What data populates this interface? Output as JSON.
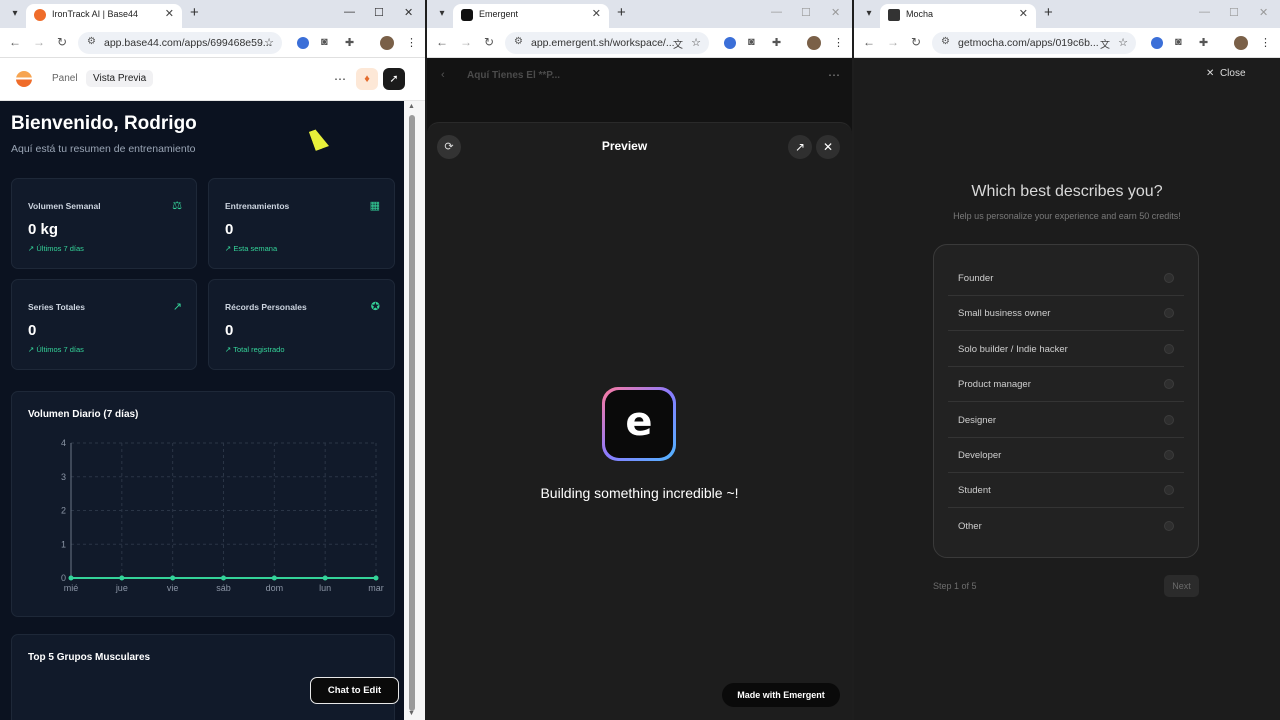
{
  "windows": {
    "base44": {
      "tab_title": "IronTrack AI | Base44",
      "url": "app.base44.com/apps/699468e59...",
      "nav_tabs": [
        "Panel",
        "Vista Previa"
      ],
      "heading": "Bienvenido, Rodrigo",
      "subheading": "Aquí está tu resumen de entrenamiento",
      "stats": [
        {
          "title": "Volumen Semanal",
          "value": "0 kg",
          "sub": "↗ Últimos 7 días",
          "icon": "weight-icon"
        },
        {
          "title": "Entrenamientos",
          "value": "0",
          "sub": "↗ Esta semana",
          "icon": "calendar-icon"
        },
        {
          "title": "Series Totales",
          "value": "0",
          "sub": "↗ Últimos 7 días",
          "icon": "trend-up-icon"
        },
        {
          "title": "Récords Personales",
          "value": "0",
          "sub": "↗ Total registrado",
          "icon": "award-icon"
        }
      ],
      "chart_title": "Volumen Diario (7 días)",
      "top_title": "Top 5 Grupos Musculares",
      "chat_button": "Chat to Edit"
    },
    "emergent": {
      "tab_title": "Emergent",
      "url": "app.emergent.sh/workspace/...",
      "header_title": "Aquí Tienes El **P...",
      "preview_title": "Preview",
      "logo_letter": "e",
      "building_text": "Building something incredible ~!",
      "made_with": "Made with Emergent"
    },
    "mocha": {
      "tab_title": "Mocha",
      "url": "getmocha.com/apps/019c6b...",
      "close_label": "Close",
      "question": "Which best describes you?",
      "subtitle": "Help us personalize your experience and earn 50 credits!",
      "options": [
        "Founder",
        "Small business owner",
        "Solo builder / Indie hacker",
        "Product manager",
        "Designer",
        "Developer",
        "Student",
        "Other"
      ],
      "step": "Step 1 of 5",
      "next": "Next"
    }
  },
  "chart_data": {
    "type": "line",
    "title": "Volumen Diario (7 días)",
    "categories": [
      "mié",
      "jue",
      "vie",
      "sáb",
      "dom",
      "lun",
      "mar"
    ],
    "series": [
      {
        "values": [
          0,
          0,
          0,
          0,
          0,
          0,
          0
        ]
      }
    ],
    "yticks": [
      0,
      1,
      2,
      3,
      4
    ],
    "ylim": [
      0,
      4
    ],
    "grid": true,
    "color": "#34d399"
  },
  "colors": {
    "accent_green": "#34d399",
    "base44_bg": "#0b1220",
    "emergent_bg": "#131313",
    "mocha_bg": "#1c1c1c"
  }
}
